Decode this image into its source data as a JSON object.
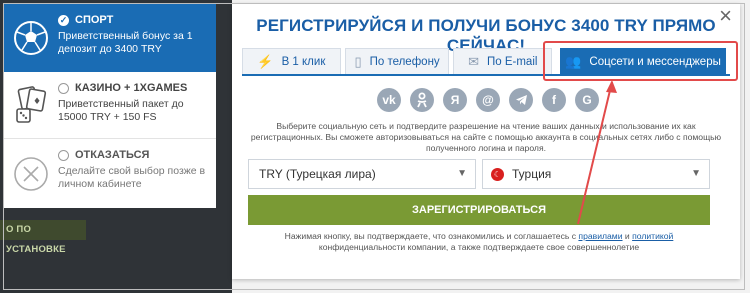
{
  "bonuses": [
    {
      "title": "СПОРТ",
      "desc": "Приветственный бонус за 1 депозит до 3400 TRY",
      "icon": "soccer-ball-icon"
    },
    {
      "title": "КАЗИНО + 1XGAMES",
      "desc": "Приветственный пакет до 15000 TRY + 150 FS",
      "icon": "casino-cards-icon"
    },
    {
      "title": "ОТКАЗАТЬСЯ",
      "desc": "Сделайте свой выбор позже в личном кабинете",
      "icon": "close-circle-icon"
    }
  ],
  "install_label": "О ПО УСТАНОВКЕ",
  "modal": {
    "title": "РЕГИСТРИРУЙСЯ И ПОЛУЧИ БОНУС 3400 TRY ПРЯМО СЕЙЧАС!",
    "close": "×",
    "tabs": [
      "В 1 клик",
      "По телефону",
      "По E-mail",
      "Соцсети и мессенджеры"
    ],
    "socials": [
      "vk-icon",
      "odnoklassniki-icon",
      "yandex-icon",
      "mailru-icon",
      "telegram-icon",
      "facebook-icon",
      "google-icon"
    ],
    "info": "Выберите социальную сеть и подтвердите разрешение на чтение ваших данных и использование их как регистрационных. Вы сможете авторизовываться на сайте с помощью аккаунта в социальных сетях либо с помощью полученного логина и пароля.",
    "currency": "TRY (Турецкая лира)",
    "country": "Турция",
    "register": "ЗАРЕГИСТРИРОВАТЬСЯ",
    "agree_pre": "Нажимая кнопку, вы подтверждаете, что ознакомились и соглашаетесь с ",
    "rules_link": "правилами",
    "agree_mid": " и ",
    "policy_link": "политикой",
    "agree_post": " конфиденциальности компании, а также подтверждаете свое совершеннолетие"
  },
  "colors": {
    "accent": "#1a6cb4",
    "register": "#7a9a34",
    "highlight": "#e24a4a"
  }
}
